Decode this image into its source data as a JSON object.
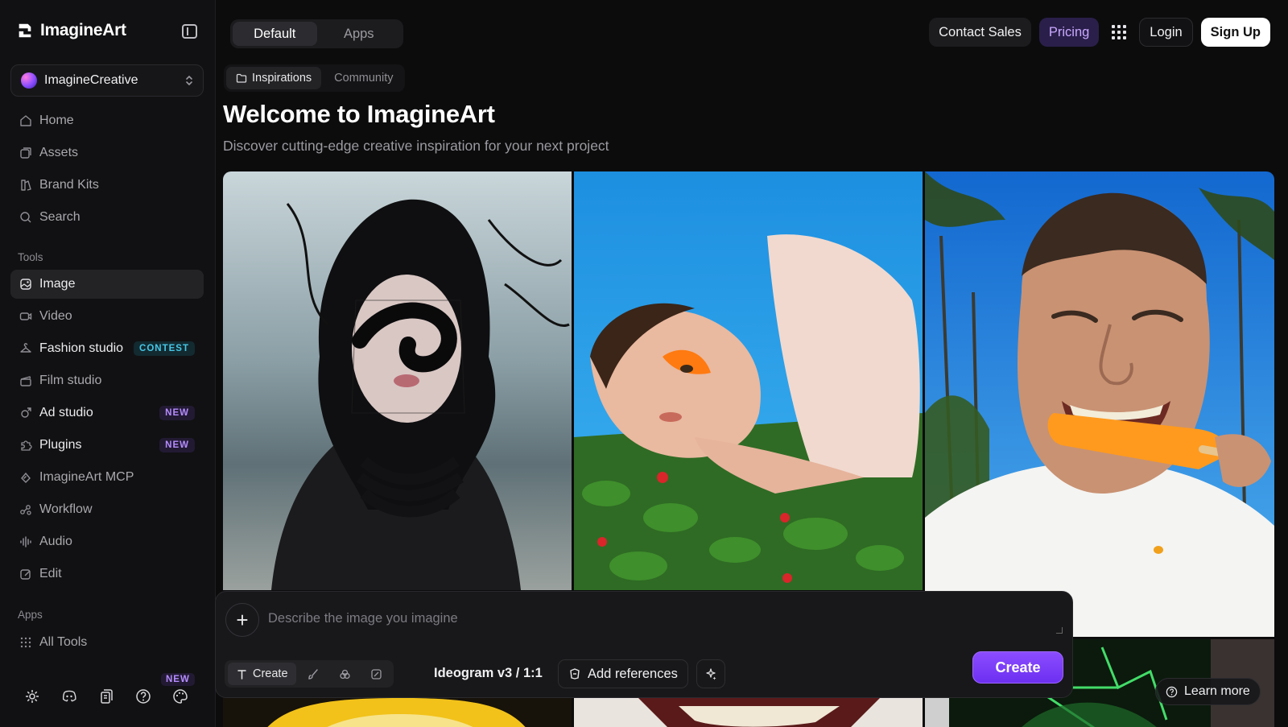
{
  "brand": {
    "name": "ImagineArt"
  },
  "workspace": {
    "name": "ImagineCreative"
  },
  "nav_main": [
    {
      "label": "Home",
      "icon": "home-icon"
    },
    {
      "label": "Assets",
      "icon": "assets-icon"
    },
    {
      "label": "Brand Kits",
      "icon": "brand-kits-icon"
    },
    {
      "label": "Search",
      "icon": "search-icon"
    }
  ],
  "sections": {
    "tools": "Tools",
    "apps": "Apps"
  },
  "nav_tools": [
    {
      "label": "Image",
      "icon": "image-icon",
      "active": true
    },
    {
      "label": "Video",
      "icon": "video-icon"
    },
    {
      "label": "Fashion studio",
      "icon": "hanger-icon",
      "badge": "CONTEST"
    },
    {
      "label": "Film studio",
      "icon": "clapper-icon"
    },
    {
      "label": "Ad studio",
      "icon": "ad-icon",
      "badge": "NEW"
    },
    {
      "label": "Plugins",
      "icon": "puzzle-icon",
      "badge": "NEW"
    },
    {
      "label": "ImagineArt MCP",
      "icon": "mcp-icon"
    },
    {
      "label": "Workflow",
      "icon": "workflow-icon"
    },
    {
      "label": "Audio",
      "icon": "audio-icon"
    },
    {
      "label": "Edit",
      "icon": "edit-icon"
    }
  ],
  "nav_apps": [
    {
      "label": "All Tools",
      "icon": "grid-icon"
    }
  ],
  "footer": {
    "new_badge": "NEW"
  },
  "mode_toggle": {
    "default": "Default",
    "apps": "Apps"
  },
  "top_right": {
    "contact": "Contact Sales",
    "pricing": "Pricing",
    "login": "Login",
    "signup": "Sign Up"
  },
  "content_tabs": {
    "inspirations": "Inspirations",
    "community": "Community"
  },
  "page": {
    "title": "Welcome to ImagineArt",
    "subtitle": "Discover cutting-edge creative inspiration for your next project"
  },
  "prompt": {
    "placeholder": "Describe the image you imagine",
    "create_mode": "Create",
    "model": "Ideogram v3 / 1:1",
    "add_references": "Add references",
    "create_button": "Create"
  },
  "learn_more": "Learn more",
  "colors": {
    "accent": "#7c3cff",
    "pricing_text": "#c9a8ff",
    "contest": "#46c7e6"
  }
}
